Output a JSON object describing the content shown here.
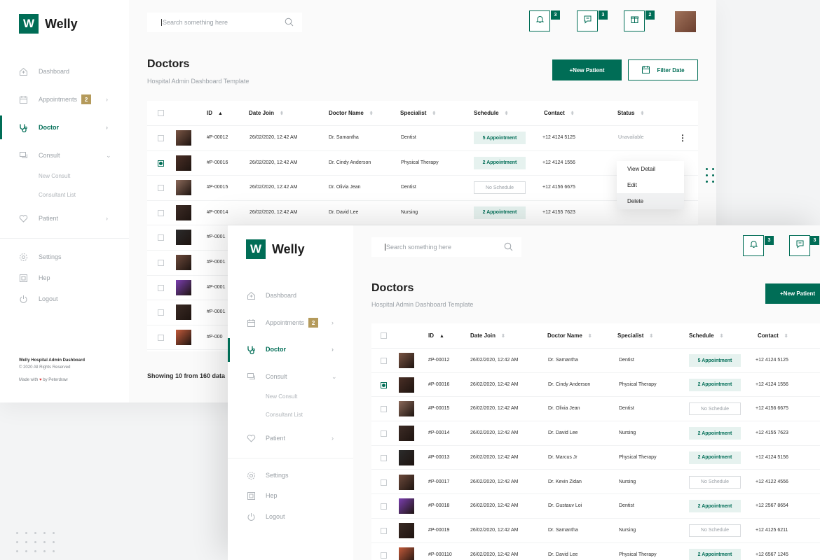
{
  "app": {
    "logo_letter": "W",
    "logo_name": "Welly"
  },
  "sidebar": {
    "items": [
      {
        "label": "Dashboard",
        "icon": "dashboard-icon"
      },
      {
        "label": "Appointments",
        "icon": "calendar-icon",
        "badge": "2"
      },
      {
        "label": "Doctor",
        "icon": "stethoscope-icon"
      },
      {
        "label": "Consult",
        "icon": "chat-icon"
      },
      {
        "label": "Patient",
        "icon": "heart-icon"
      }
    ],
    "consult_sub": [
      "New Consult",
      "Consultant List"
    ],
    "bottom": [
      {
        "label": "Settings",
        "icon": "gear-icon"
      },
      {
        "label": "Hep",
        "icon": "help-icon"
      },
      {
        "label": "Logout",
        "icon": "power-icon"
      }
    ],
    "footer": {
      "title": "Welly Hospital Admin Dashboard",
      "copyright": "© 2020 All Rights Reserved",
      "made_prefix": "Made with",
      "made_suffix": "by Peterdraw"
    }
  },
  "header": {
    "search_placeholder": "Search something here",
    "notif_badges": [
      "3",
      "3",
      "2"
    ]
  },
  "page": {
    "title": "Doctors",
    "subtitle": "Hospital Admin Dashboard Template",
    "new_patient_label": "+New Patient",
    "filter_date_label": "Filter Date",
    "showing": "Showing 10 from 160 data"
  },
  "table": {
    "columns": [
      "ID",
      "Date Join",
      "Doctor Name",
      "Specialist",
      "Schedule",
      "Contact",
      "Status"
    ],
    "rows": [
      {
        "id": "#P-00012",
        "date": "26/02/2020, 12:42 AM",
        "name": "Dr. Samantha",
        "spec": "Dentist",
        "schedule": "5 Appointment",
        "contact": "+12 4124 5125",
        "status": "Unavailable",
        "checked": false
      },
      {
        "id": "#P-00016",
        "date": "26/02/2020, 12:42 AM",
        "name": "Dr. Cindy Anderson",
        "spec": "Physical Therapy",
        "schedule": "2 Appointment",
        "contact": "+12 4124 1556",
        "status": "",
        "checked": true
      },
      {
        "id": "#P-00015",
        "date": "26/02/2020, 12:42 AM",
        "name": "Dr. Olivia Jean",
        "spec": "Dentist",
        "schedule": "No Schedule",
        "contact": "+12 4156 6675",
        "status": "",
        "checked": false
      },
      {
        "id": "#P-00014",
        "date": "26/02/2020, 12:42 AM",
        "name": "Dr. David Lee",
        "spec": "Nursing",
        "schedule": "2 Appointment",
        "contact": "+12 4155 7623",
        "status": "",
        "checked": false
      },
      {
        "id": "#P-00013",
        "date": "26/02/2020, 12:42 AM",
        "name": "Dr. Marcus Jr",
        "spec": "Physical Therapy",
        "schedule": "2 Appointment",
        "contact": "+12 4124 5156",
        "status": "",
        "checked": false
      },
      {
        "id": "#P-00017",
        "date": "26/02/2020, 12:42 AM",
        "name": "Dr. Kevin Zidan",
        "spec": "Nursing",
        "schedule": "No Schedule",
        "contact": "+12 4122 4556",
        "status": "",
        "checked": false
      },
      {
        "id": "#P-00018",
        "date": "26/02/2020, 12:42 AM",
        "name": "Dr. Gustauv Loi",
        "spec": "Dentist",
        "schedule": "2 Appointment",
        "contact": "+12 2567 8654",
        "status": "",
        "checked": false
      },
      {
        "id": "#P-00019",
        "date": "26/02/2020, 12:42 AM",
        "name": "Dr. Samantha",
        "spec": "Nursing",
        "schedule": "No Schedule",
        "contact": "+12 4125 6211",
        "status": "",
        "checked": false
      },
      {
        "id": "#P-000110",
        "date": "26/02/2020, 12:42 AM",
        "name": "Dr. David Lee",
        "spec": "Physical Therapy",
        "schedule": "2 Appointment",
        "contact": "+12 6567 1245",
        "status": "",
        "checked": false
      }
    ],
    "back_ids_partial": [
      "#P-0001",
      "#P-0001",
      "#P-0001",
      "#P-0001",
      "#P-000"
    ]
  },
  "context_menu": [
    "View Detail",
    "Edit",
    "Delete"
  ],
  "colors": {
    "primary": "#006d56",
    "badge_gold": "#b49a5b",
    "appt_bg": "#e6f2ef"
  }
}
